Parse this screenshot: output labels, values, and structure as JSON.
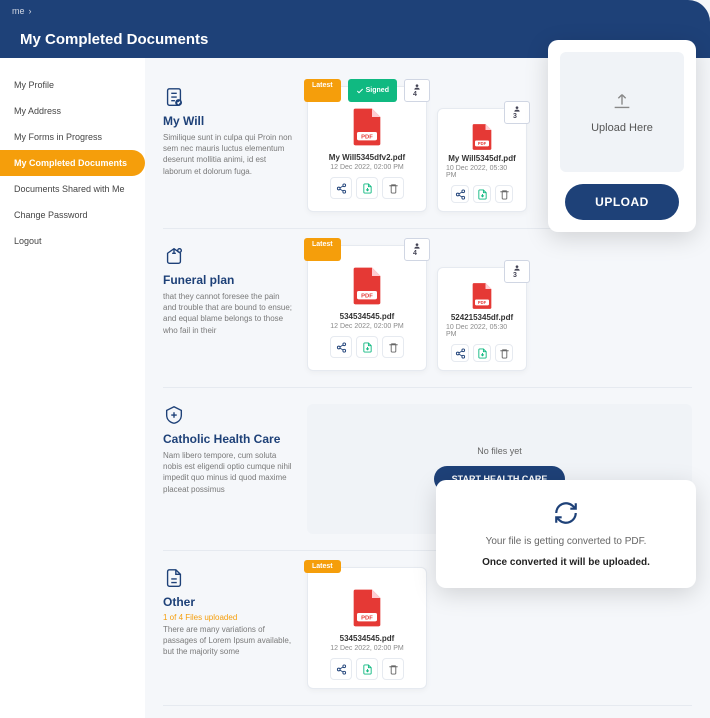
{
  "breadcrumb": {
    "home": "me"
  },
  "page_title": "My Completed Documents",
  "sidebar": {
    "items": [
      {
        "label": "My Profile"
      },
      {
        "label": "My Address"
      },
      {
        "label": "My Forms in Progress"
      },
      {
        "label": "My Completed Documents"
      },
      {
        "label": "Documents Shared with Me"
      },
      {
        "label": "Change Password"
      },
      {
        "label": "Logout"
      }
    ]
  },
  "sections": [
    {
      "title": "My Will",
      "desc": "Similique sunt in culpa qui Proin non sem nec mauris luctus elementum deserunt mollitia animi, id est laborum et dolorum fuga.",
      "files": [
        {
          "latest": "Latest",
          "signed": "Signed",
          "count": "4",
          "name": "My Will5345dfv2.pdf",
          "date": "12 Dec 2022, 02:00 PM"
        },
        {
          "count": "3",
          "name": "My Will5345df.pdf",
          "date": "10 Dec 2022, 05:30 PM",
          "small": true
        }
      ]
    },
    {
      "title": "Funeral plan",
      "desc": "that they cannot foresee the pain and trouble that are bound to ensue; and equal blame belongs to those who fail in their",
      "files": [
        {
          "latest": "Latest",
          "count": "4",
          "name": "534534545.pdf",
          "date": "12 Dec 2022, 02:00 PM"
        },
        {
          "count": "3",
          "name": "524215345df.pdf",
          "date": "10 Dec 2022, 05:30 PM",
          "small": true
        }
      ]
    },
    {
      "title": "Catholic Health Care",
      "desc": "Nam libero tempore, cum soluta nobis est eligendi optio cumque nihil impedit quo minus id quod maxime placeat possimus",
      "empty": {
        "text": "No files yet",
        "button": "START HEALTH CARE"
      }
    },
    {
      "title": "Other",
      "sub": "1 of 4 Files uploaded",
      "desc": "There are many variations of passages of Lorem Ipsum available, but the majority some",
      "files": [
        {
          "latest": "Latest",
          "name": "534534545.pdf",
          "date": "12 Dec 2022, 02:00 PM"
        }
      ]
    }
  ],
  "upload": {
    "dropzone": "Upload Here",
    "button": "UPLOAD"
  },
  "toast": {
    "line1": "Your file is getting converted to PDF.",
    "line2": "Once converted it will be uploaded."
  }
}
